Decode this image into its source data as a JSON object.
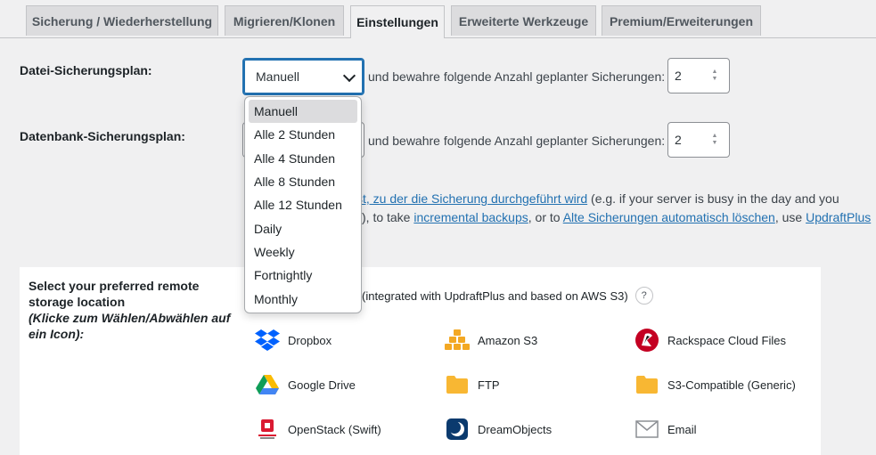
{
  "tabs": [
    {
      "label": "Sicherung / Wiederherstellung"
    },
    {
      "label": "Migrieren/Klonen"
    },
    {
      "label": "Einstellungen"
    },
    {
      "label": "Erweiterte Werkzeuge"
    },
    {
      "label": "Premium/Erweiterungen"
    }
  ],
  "files": {
    "label": "Datei-Sicherungsplan:",
    "selected": "Manuell",
    "retain_text": "und bewahre folgende Anzahl geplanter Sicherungen:",
    "retain_value": "2"
  },
  "database": {
    "label": "Datenbank-Sicherungsplan:",
    "retain_text": "und bewahre folgende Anzahl geplanter Sicherungen:",
    "retain_value": "2"
  },
  "info": {
    "line1_link": "st, zu der die Sicherung durchgeführt wird",
    "line1_rest": " (e.g. if your server is busy in the day and you",
    "line2_a": "), to take ",
    "line2_link1": "incremental backups",
    "line2_b": ", or to ",
    "line2_link2": "Alte Sicherungen automatisch löschen",
    "line2_c": ", use ",
    "line2_link3": "UpdraftPlus"
  },
  "remote": {
    "title": "Select your preferred remote storage location",
    "subtitle": "(Klicke zum Wählen/Abwählen auf ein Icon):",
    "intro": "(integrated with UpdraftPlus and based on AWS S3)",
    "help": "?",
    "providers": [
      {
        "name": "Dropbox",
        "icon": "dropbox-icon"
      },
      {
        "name": "Amazon S3",
        "icon": "amazon-s3-icon"
      },
      {
        "name": "Rackspace Cloud Files",
        "icon": "rackspace-icon"
      },
      {
        "name": "Google Drive",
        "icon": "google-drive-icon"
      },
      {
        "name": "FTP",
        "icon": "folder-icon"
      },
      {
        "name": "S3-Compatible (Generic)",
        "icon": "folder-icon"
      },
      {
        "name": "OpenStack (Swift)",
        "icon": "openstack-icon"
      },
      {
        "name": "DreamObjects",
        "icon": "dreamobjects-icon"
      },
      {
        "name": "Email",
        "icon": "email-icon"
      }
    ]
  },
  "dropdown_options": [
    "Manuell",
    "Alle 2 Stunden",
    "Alle 4 Stunden",
    "Alle 8 Stunden",
    "Alle 12 Stunden",
    "Daily",
    "Weekly",
    "Fortnightly",
    "Monthly"
  ],
  "colors": {
    "link": "#2271b1",
    "focus": "#2271b1",
    "background": "#f0f0f1"
  }
}
